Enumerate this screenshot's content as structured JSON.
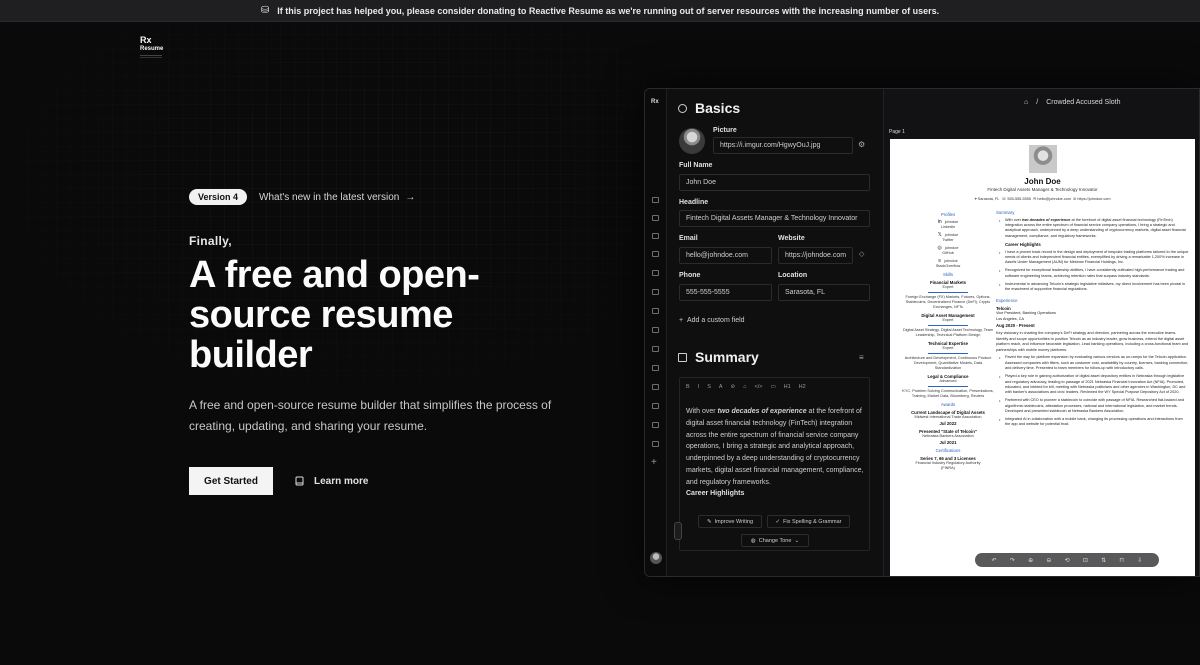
{
  "banner": {
    "text": "If this project has helped you, please consider donating to Reactive Resume as we're running out of server resources with the increasing number of users."
  },
  "logo": {
    "mark": "Rx",
    "word": "Resume"
  },
  "hero": {
    "version_badge": "Version 4",
    "version_link": "What's new in the latest version",
    "kicker": "Finally,",
    "title": "A free and open-source resume builder",
    "lead": "A free and open-source resume builder that simplifies the process of creating, updating, and sharing your resume.",
    "cta_primary": "Get Started",
    "cta_secondary": "Learn more"
  },
  "app": {
    "rail_logo": "Rx",
    "basics": {
      "title": "Basics",
      "picture_label": "Picture",
      "picture_value": "https://i.imgur.com/HgwyOuJ.jpg",
      "full_name_label": "Full Name",
      "full_name_value": "John Doe",
      "headline_label": "Headline",
      "headline_value": "Fintech Digital Assets Manager & Technology Innovator",
      "email_label": "Email",
      "email_value": "hello@johndoe.com",
      "website_label": "Website",
      "website_value": "https://johndoe.com",
      "phone_label": "Phone",
      "phone_value": "555-555-5555",
      "location_label": "Location",
      "location_value": "Sarasota, FL",
      "add_custom": "Add a custom field"
    },
    "summary": {
      "title": "Summary",
      "toolbar": [
        "B",
        "I",
        "S",
        "A",
        "⊘",
        "⌂",
        "</>",
        "▭",
        "H1",
        "H2"
      ],
      "text_pre": "With over ",
      "text_em": "two decades of experience",
      "text_post": " at the forefront of digital asset financial technology (FinTech) integration across the entire spectrum of financial service company operations, I bring a strategic and analytical approach, underpinned by a deep understanding of cryptocurrency markets, digital asset financial management, compliance, and regulatory frameworks.",
      "subhead": "Career Highlights",
      "ai_improve": "Improve Writing",
      "ai_fix": "Fix Spelling & Grammar",
      "ai_tone": "Change Tone"
    },
    "breadcrumb": {
      "title": "Crowded Accused Sloth"
    },
    "preview": {
      "page_label": "Page 1",
      "name": "John Doe",
      "headline": "Fintech Digital Assets Manager & Technology Innovator",
      "contact": [
        "Sarasota, FL",
        "555-555-5555",
        "hello@johndoe.com",
        "https://johndoe.com"
      ],
      "profiles_title": "Profiles",
      "profiles": [
        {
          "user": "johndoe",
          "network": "LinkedIn",
          "icon": "in"
        },
        {
          "user": "johndoe",
          "network": "Twitter",
          "icon": "𝕏"
        },
        {
          "user": "johndoe",
          "network": "GitHub",
          "icon": "◎"
        },
        {
          "user": "johndoe",
          "network": "StackOverflow",
          "icon": "≡"
        }
      ],
      "skills_title": "Skills",
      "skills": [
        {
          "name": "Financial Markets",
          "level": "Expert",
          "keywords": "Foreign Exchange (FX) Markets, Futures, Options, Stablecoins, Decentralized Finance (DeFi), Crypto Exchanges, NFTs"
        },
        {
          "name": "Digital Asset Management",
          "level": "Expert",
          "keywords": "Digital Asset Strategy, Digital Asset Technology, Team Leadership, Technical Platform Design"
        },
        {
          "name": "Technical Expertise",
          "level": "Expert",
          "keywords": "Architecture and Development, Continuous Product Development, Quantitative Models, Data Standardization"
        },
        {
          "name": "Legal & Compliance",
          "level": "Advanced",
          "keywords": "KYC, Problem Solving Communication, Presentations, Training, Market Data, Bloomberg, Reuters"
        }
      ],
      "awards_title": "Awards",
      "awards": [
        {
          "title": "Current Landscape of Digital Assets",
          "org": "Midwest International Trade Association",
          "date": "Jul 2022"
        },
        {
          "title": "Presented \"State of Telcoin\"",
          "org": "Nebraska Bankers Association",
          "date": "Jul 2021"
        }
      ],
      "certs_title": "Certifications",
      "certs": [
        {
          "title": "Series 7, 66 and 3 Licenses",
          "org": "Financial Industry Regulatory Authority",
          "date": "(FINRA)"
        }
      ],
      "summary_title": "Summary",
      "summary_intro_pre": "With over ",
      "summary_intro_em": "two decades of experience",
      "summary_intro_post": " at the forefront of digital asset financial technology (FinTech) integration across the entire spectrum of financial service company operations, I bring a strategic and analytical approach, underpinned by a deep understanding of cryptocurrency markets, digital asset financial management, compliance, and regulatory frameworks.",
      "career_title": "Career Highlights",
      "career": [
        "I have a proven track record in the design and deployment of bespoke trading platforms tailored to the unique needs of clients and independent financial entities, exemplified by driving a remarkable 1,200% increase in Assets Under Management (AUM) for Mesirow Financial Holdings, Inc.",
        "Recognized for exceptional leadership abilities, I have consistently cultivated high-performance trading and software engineering teams, achieving retention rates that surpass industry standards.",
        "Instrumental in advancing Telcoin's strategic legislative initiatives, my direct involvement has been pivotal in the enactment of supportive financial regulations."
      ],
      "experience_title": "Experience",
      "exp_company": "Telcoin",
      "exp_role": "Vice President, Banking Operations",
      "exp_location": "Los Angeles, CA",
      "exp_date": "Aug 2020 - Present",
      "exp_desc": "Key visionary in charting the company's DeFi strategy and direction, partnering across the executive teams. Identify and scope opportunities to position Telcoin as an industry leader, grow business, extend the digital asset platform reach, and influence favorable legislation. Lead banking operations, including a cross-functional team and partnerships with mobile money platforms.",
      "exp_bullets": [
        "Paved the way for platform expansion by evaluating various vendors as on-ramps for the Telcoin application. Assessed companies with filters, such as customer cost, availability by country, licenses, banking connection, and delivery time. Presented to team members for follow-up with introductory calls.",
        "Played a key role in gaining authorization of digital asset depository entities in Nebraska through legislative and regulatory advocacy, leading to passage of 2021 Nebraska Financial Innovation Act (NFIA). Promoted, educated, and lobbied for bill, meeting with Nebraska politicians and other agencies in Washington, DC and with banker's associations and civic leaders. Reviewed the WY Special Purpose Depository Act of 2020.",
        "Partnered with CEO to pioneer a stablecoin to coincide with passage of NFIA. Researched fiat-backed and algorithmic stablecoins, attestation processes, national and international legislation, and market trends. Developed and presented stablecoin at Nebraska Bankers Association.",
        "Integrated AI in collaboration with a mobile bank, changing its processing operations and interactions from the app and website for potential trust."
      ]
    }
  }
}
